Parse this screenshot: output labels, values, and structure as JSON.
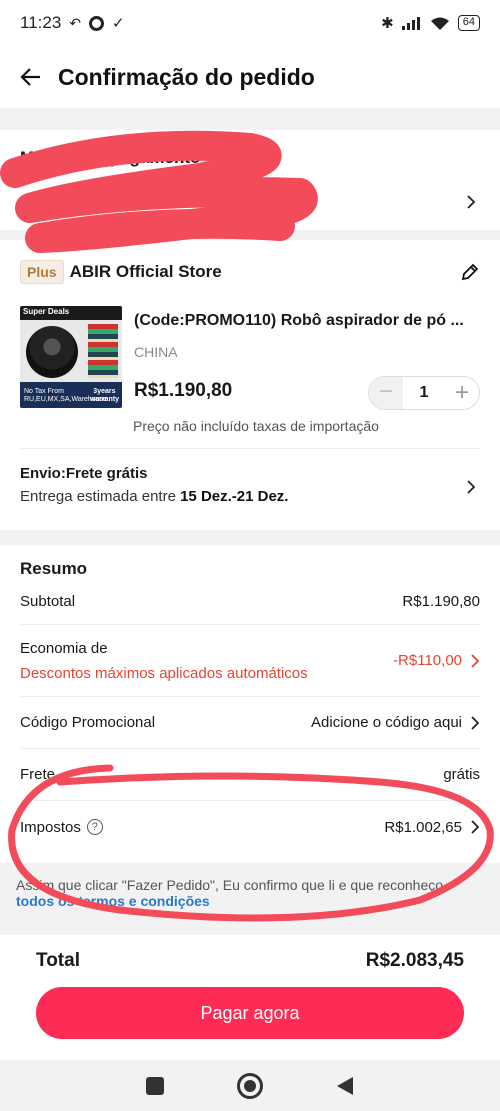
{
  "status_bar": {
    "time": "11:23",
    "battery": "64"
  },
  "header": {
    "title": "Confirmação do pedido"
  },
  "payment": {
    "title": "Método de pagamento"
  },
  "store": {
    "badge": "Plus",
    "name": "ABIR Official Store",
    "product": {
      "title": "(Code:PROMO110) Robô aspirador de pó ...",
      "origin": "CHINA",
      "price": "R$1.190,80",
      "quantity": "1",
      "minus": "−",
      "plus": "+",
      "note": "Preço não incluído taxas de importação",
      "thumb_deal": "Super Deals",
      "thumb_tax": "No Tax From\nRU,EU,MX,SA,Warehouse",
      "thumb_years": "3years\nwarranty"
    },
    "shipping": {
      "label": "Envio:Frete grátis",
      "estimate_prefix": "Entrega estimada entre ",
      "estimate_dates": "15 Dez.-21 Dez."
    }
  },
  "summary": {
    "title": "Resumo",
    "subtotal_label": "Subtotal",
    "subtotal_value": "R$1.190,80",
    "economia_label": "Economia de",
    "economia_sub": "Descontos máximos aplicados automáticos",
    "economia_value": "-R$110,00",
    "promo_label": "Código Promocional",
    "promo_value": "Adicione o código aqui",
    "frete_label": "Frete",
    "frete_value": "grátis",
    "impostos_label": "Impostos",
    "impostos_value": "R$1.002,65",
    "terms_text": "Assim que clicar \"Fazer Pedido\", Eu confirmo que li e que reconheço",
    "terms_link": "todos os termos e condições"
  },
  "footer": {
    "total_label": "Total",
    "total_value": "R$2.083,45",
    "pay_button": "Pagar agora"
  },
  "colors": {
    "accent": "#fe2c55",
    "discount": "#e44530",
    "link": "#2b78c6",
    "scribble": "#f24b5a"
  },
  "icons": [
    "back-arrow-icon",
    "chevron-right-icon",
    "edit-pencil-icon",
    "help-icon",
    "bluetooth-icon",
    "signal-icon",
    "wifi-icon",
    "battery-icon",
    "nav-recents-icon",
    "nav-home-icon",
    "nav-back-icon"
  ]
}
